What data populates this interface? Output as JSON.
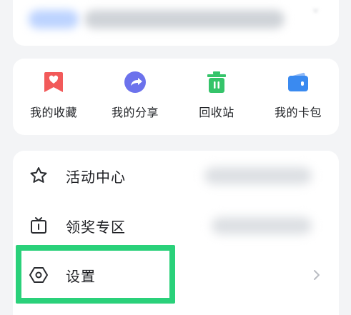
{
  "shortcuts": [
    {
      "label": "我的收藏",
      "icon": "bookmark-heart-icon",
      "color": "#f25a5a"
    },
    {
      "label": "我的分享",
      "icon": "share-icon",
      "color": "#6c72ec"
    },
    {
      "label": "回收站",
      "icon": "trash-icon",
      "color": "#35c46a"
    },
    {
      "label": "我的卡包",
      "icon": "wallet-icon",
      "color": "#3a8af0"
    }
  ],
  "menu": [
    {
      "label": "活动中心",
      "icon": "star-icon"
    },
    {
      "label": "领奖专区",
      "icon": "tv-gift-icon"
    },
    {
      "label": "设置",
      "icon": "settings-hexagon-icon"
    }
  ],
  "colors": {
    "highlight": "#2ad17a",
    "background": "#f3f4f6"
  }
}
